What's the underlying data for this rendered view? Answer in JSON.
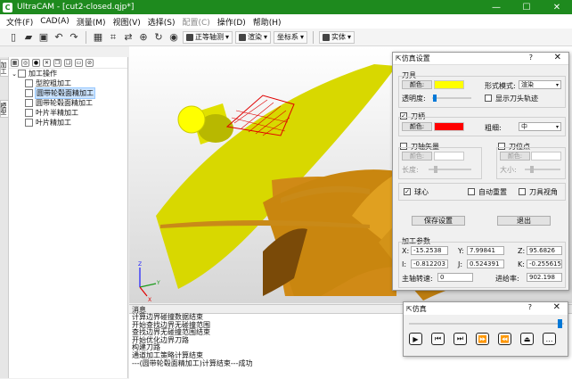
{
  "window": {
    "title": "UltraCAM - [cut2-closed.qjp*]",
    "app_icon": "C",
    "controls": {
      "minimize": "—",
      "maximize": "☐",
      "close": "✕"
    }
  },
  "menu": [
    "文件(F)",
    "CAD(A)",
    "测量(M)",
    "视图(V)",
    "选择(S)",
    "配置(C)",
    "操作(D)",
    "帮助(H)"
  ],
  "toolbar": {
    "view_combo": "正等轴测",
    "render_combo": "渲染",
    "coord_label": "坐标系",
    "solid_combo": "实体"
  },
  "left_tabs": [
    "加工",
    "模型"
  ],
  "tree": {
    "root": "加工操作",
    "items": [
      "型腔粗加工",
      "圆带轮毂面精加工",
      "圆带轮毂面精加工",
      "叶片半精加工",
      "叶片精加工"
    ]
  },
  "messages": {
    "header": "消息",
    "lines": [
      "计算边界碰撞数据结束",
      "开始查找边界无碰撞范围",
      "查找边界无碰撞范围结束",
      "开始优化边界刀路",
      "构建刀路",
      "通道加工策略计算结束",
      "---(圆带轮毂面精加工)计算结束---成功"
    ]
  },
  "sim_settings": {
    "title": "仿真设置",
    "help": "?",
    "close": "✕",
    "tool_group": "刀具",
    "color_btn": "颜色:",
    "tool_color": "#ffff00",
    "shape_label": "形式模式:",
    "shape_value": "渲染",
    "transparency_label": "透明度:",
    "transparency": 0.1,
    "show_path_label": "显示刀头轨迹",
    "holder_label": "刀柄",
    "holder_checked": true,
    "holder_color": "#ff0000",
    "thickness_label": "粗细:",
    "thickness_value": "中",
    "tool_vector_label": "刀轴矢量",
    "tool_pos_label": "刀位点",
    "length_label": "长度:",
    "size_label": "大小:",
    "sphere_label": "球心",
    "sphere_checked": true,
    "auto_reset_label": "自动重置",
    "tool_view_label": "刀具视角",
    "save_btn": "保存设置",
    "exit_btn": "退出",
    "params_title": "加工参数",
    "X": "-15.2538",
    "Y": "7.99841",
    "Z": "95.6826",
    "I": "-0.812203",
    "J": "0.524391",
    "K": "-0.255615",
    "spindle_label": "主轴转速:",
    "spindle": "0",
    "feed_label": "进给率:",
    "feed": "902.198"
  },
  "player": {
    "title": "仿真",
    "help": "?",
    "close": "✕",
    "progress": 0.97,
    "buttons": [
      "▶",
      "⏮",
      "⏭",
      "⏩",
      "⏪",
      "⏏",
      "…"
    ]
  },
  "axes": {
    "x": "X",
    "y": "Y",
    "z": "Z"
  }
}
